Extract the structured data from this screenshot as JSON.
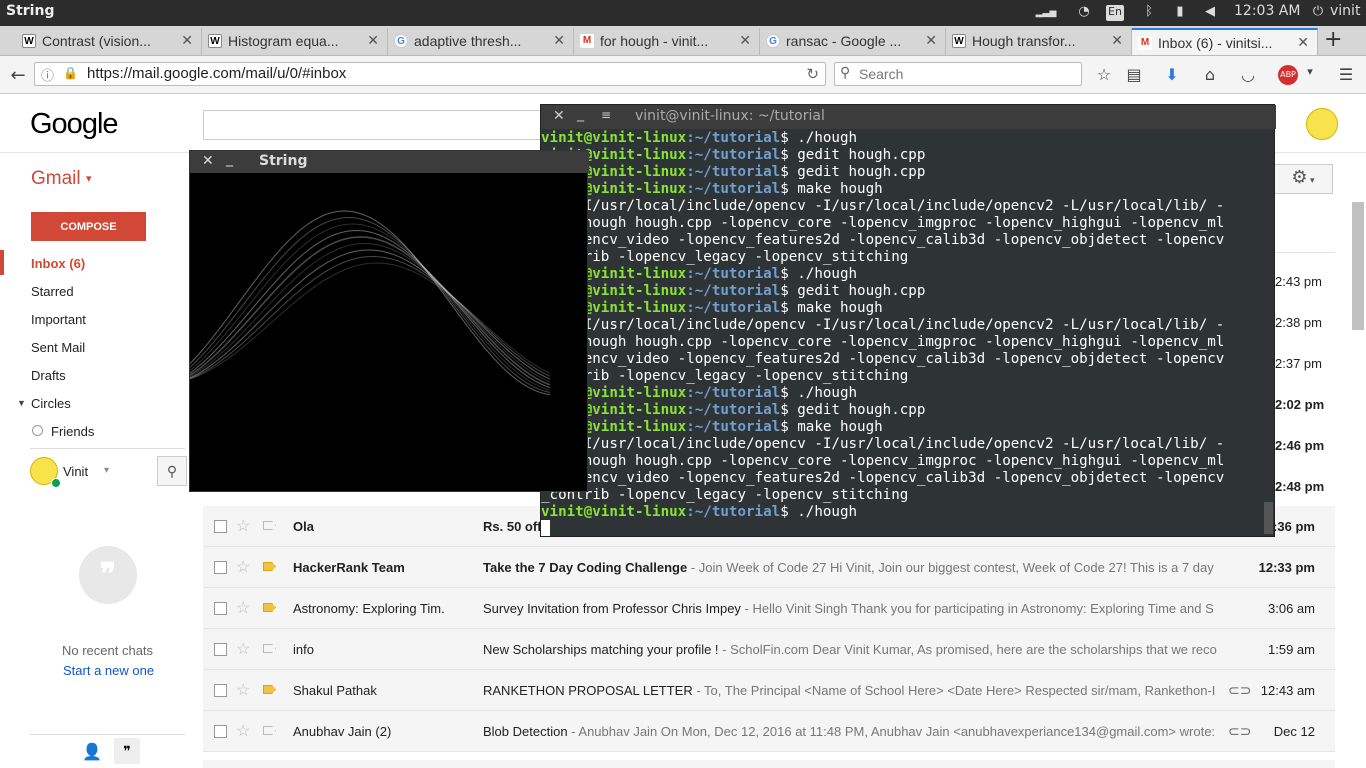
{
  "topbar": {
    "title": "String",
    "lang": "En",
    "time": "12:03 AM",
    "user": "vinit"
  },
  "tabs": [
    {
      "label": "Contrast (vision...",
      "fav": "W"
    },
    {
      "label": "Histogram equa...",
      "fav": "W"
    },
    {
      "label": "adaptive thresh...",
      "fav": "G"
    },
    {
      "label": "for hough - vinit...",
      "fav": "M"
    },
    {
      "label": "ransac - Google ...",
      "fav": "G"
    },
    {
      "label": "Hough transfor...",
      "fav": "W"
    },
    {
      "label": "Inbox (6) - vinitsi...",
      "fav": "M"
    }
  ],
  "urlbar": {
    "url": "https://mail.google.com/mail/u/0/#inbox",
    "search_placeholder": "Search"
  },
  "gmail": {
    "logo": "Google",
    "brand": "Gmail",
    "compose": "COMPOSE",
    "nav": [
      "Inbox (6)",
      "Starred",
      "Important",
      "Sent Mail",
      "Drafts",
      "Circles",
      "Friends"
    ],
    "user": "Vinit",
    "no_chats": "No recent chats",
    "start_new": "Start a new one",
    "bg_dates": [
      "2:43 pm",
      "2:38 pm",
      "2:37 pm",
      "2:02 pm",
      "2:46 pm",
      "2:48 pm"
    ],
    "rows": [
      {
        "sender": "Ola",
        "subject": "Rs. 50 off",
        "snippet": "",
        "date": "2:36 pm",
        "unread": true,
        "important": false,
        "attach": false
      },
      {
        "sender": "HackerRank Team",
        "subject": "Take the 7 Day Coding Challenge",
        "snippet": " - Join Week of Code 27 Hi Vinit, Join our biggest contest, Week of Code 27! This is a 7 day",
        "date": "12:33 pm",
        "unread": true,
        "important": true,
        "attach": false
      },
      {
        "sender": "Astronomy: Exploring Tim.",
        "subject": "Survey Invitation from Professor Chris Impey",
        "snippet": " - Hello Vinit Singh Thank you for participating in Astronomy: Exploring Time and S",
        "date": "3:06 am",
        "unread": false,
        "important": true,
        "attach": false
      },
      {
        "sender": "info",
        "subject": "New Scholarships matching your profile !",
        "snippet": " - ScholFin.com Dear Vinit Kumar, As promised, here are the scholarships that we reco",
        "date": "1:59 am",
        "unread": false,
        "important": false,
        "attach": false
      },
      {
        "sender": "Shakul Pathak",
        "subject": "RANKETHON PROPOSAL LETTER",
        "snippet": " - To, The Principal <Name of School Here> <Date Here> Respected sir/mam, Rankethon-I",
        "date": "12:43 am",
        "unread": false,
        "important": true,
        "attach": true
      },
      {
        "sender": "Anubhav Jain (2)",
        "subject": "Blob Detection",
        "snippet": " - Anubhav Jain On Mon, Dec 12, 2016 at 11:48 PM, Anubhav Jain <anubhavexperiance134@gmail.com> wrote:",
        "date": "Dec 12",
        "unread": false,
        "important": false,
        "attach": true
      }
    ]
  },
  "terminal": {
    "title": "vinit@vinit-linux: ~/tutorial",
    "prompt_user": "vinit@vinit-linux",
    "prompt_dir": ":~/tutorial",
    "lines": [
      {
        "p": true,
        "t": "$ ./hough"
      },
      {
        "p": true,
        "t": "$ gedit hough.cpp"
      },
      {
        "p": true,
        "t": "$ gedit hough.cpp"
      },
      {
        "p": true,
        "t": "$ make hough"
      },
      {
        "p": false,
        "t": "g++ -I/usr/local/include/opencv -I/usr/local/include/opencv2 -L/usr/local/lib/ -"
      },
      {
        "p": false,
        "t": "g -o hough hough.cpp -lopencv_core -lopencv_imgproc -lopencv_highgui -lopencv_ml"
      },
      {
        "p": false,
        "t": " -lopencv_video -lopencv_features2d -lopencv_calib3d -lopencv_objdetect -lopencv"
      },
      {
        "p": false,
        "t": "_contrib -lopencv_legacy -lopencv_stitching"
      },
      {
        "p": true,
        "t": "$ ./hough"
      },
      {
        "p": true,
        "t": "$ gedit hough.cpp"
      },
      {
        "p": true,
        "t": "$ make hough"
      },
      {
        "p": false,
        "t": "g++ -I/usr/local/include/opencv -I/usr/local/include/opencv2 -L/usr/local/lib/ -"
      },
      {
        "p": false,
        "t": "g -o hough hough.cpp -lopencv_core -lopencv_imgproc -lopencv_highgui -lopencv_ml"
      },
      {
        "p": false,
        "t": " -lopencv_video -lopencv_features2d -lopencv_calib3d -lopencv_objdetect -lopencv"
      },
      {
        "p": false,
        "t": "_contrib -lopencv_legacy -lopencv_stitching"
      },
      {
        "p": true,
        "t": "$ ./hough"
      },
      {
        "p": true,
        "t": "$ gedit hough.cpp"
      },
      {
        "p": true,
        "t": "$ make hough"
      },
      {
        "p": false,
        "t": "g++ -I/usr/local/include/opencv -I/usr/local/include/opencv2 -L/usr/local/lib/ -"
      },
      {
        "p": false,
        "t": "g -o hough hough.cpp -lopencv_core -lopencv_imgproc -lopencv_highgui -lopencv_ml"
      },
      {
        "p": false,
        "t": " -lopencv_video -lopencv_features2d -lopencv_calib3d -lopencv_objdetect -lopencv"
      },
      {
        "p": false,
        "t": "_contrib -lopencv_legacy -lopencv_stitching"
      },
      {
        "p": true,
        "t": "$ ./hough"
      }
    ]
  },
  "string_window": {
    "title": "String"
  }
}
